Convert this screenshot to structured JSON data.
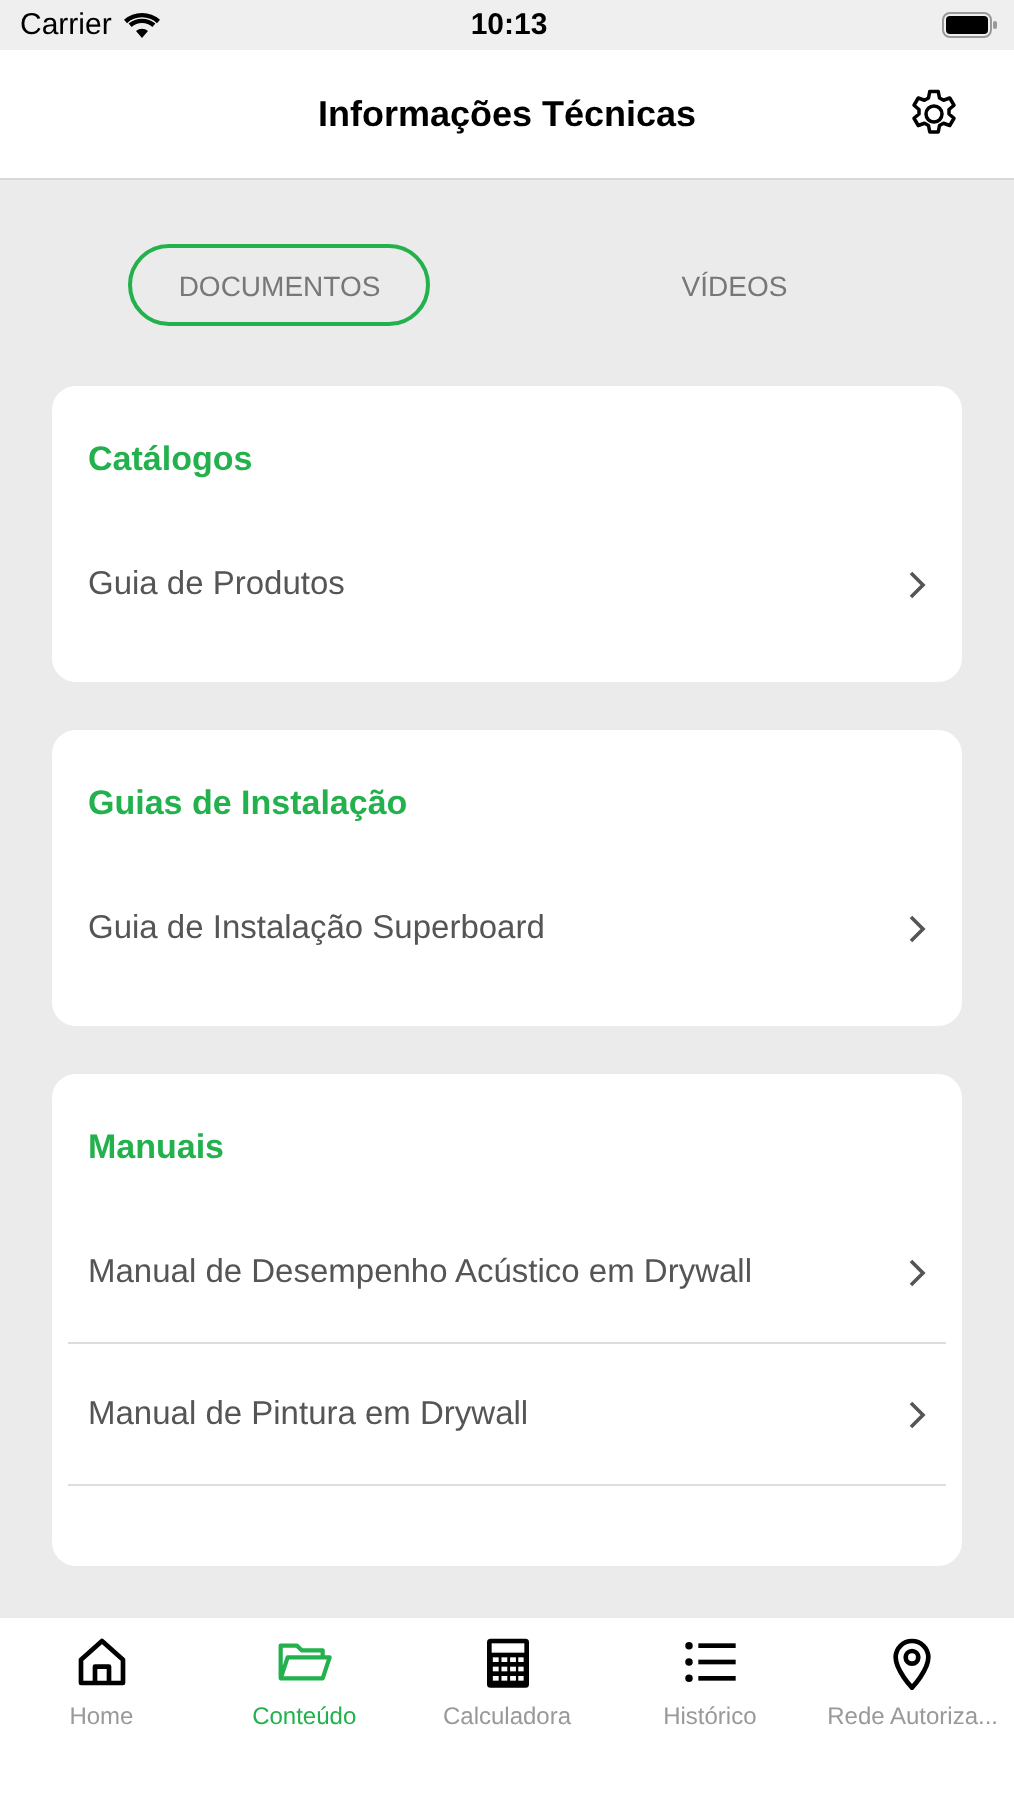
{
  "status_bar": {
    "carrier": "Carrier",
    "time": "10:13"
  },
  "nav": {
    "title": "Informações Técnicas"
  },
  "segments": [
    {
      "label": "DOCUMENTOS",
      "selected": true
    },
    {
      "label": "VÍDEOS",
      "selected": false
    }
  ],
  "sections": [
    {
      "title": "Catálogos",
      "items": [
        "Guia de Produtos"
      ]
    },
    {
      "title": "Guias de Instalação",
      "items": [
        "Guia de Instalação Superboard"
      ]
    },
    {
      "title": "Manuais",
      "items": [
        "Manual de Desempenho Acústico em Drywall",
        "Manual de Pintura em Drywall"
      ],
      "more_below": true
    }
  ],
  "tab_bar": [
    {
      "kind": "home",
      "label": "Home",
      "selected": false
    },
    {
      "kind": "folder",
      "label": "Conteúdo",
      "selected": true
    },
    {
      "kind": "calculator",
      "label": "Calculadora",
      "selected": false
    },
    {
      "kind": "list",
      "label": "Histórico",
      "selected": false
    },
    {
      "kind": "pin",
      "label": "Rede Autoriza...",
      "selected": false
    }
  ]
}
